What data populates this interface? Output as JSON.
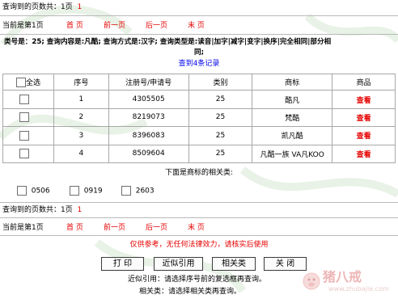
{
  "pager_top": {
    "total_label": "查询到的页数共：1页",
    "total_pages": "1",
    "current_label": "当前是第1页",
    "first": "首 页",
    "prev": "前一页",
    "next": "后一页",
    "last": "末 页"
  },
  "query_desc": "类号是：25; 查询内容是:凡酷; 查询方式是:汉字; 查询类型是:读音|加字|减字|变字|换序|完全相同|部分相",
  "query_desc_wrap": "同;",
  "result_count": "查到4条记录",
  "table": {
    "select_all": "全选",
    "headers": [
      "序号",
      "注册号/申请号",
      "类别",
      "商标",
      "商品"
    ],
    "rows": [
      {
        "seq": "1",
        "reg": "4305505",
        "cls": "25",
        "mark": "酷凡",
        "goods": "查看"
      },
      {
        "seq": "2",
        "reg": "8219073",
        "cls": "25",
        "mark": "梵酷",
        "goods": "查看"
      },
      {
        "seq": "3",
        "reg": "8396083",
        "cls": "25",
        "mark": "凯凡酷",
        "goods": "查看"
      },
      {
        "seq": "4",
        "reg": "8509604",
        "cls": "25",
        "mark": "凡酷一族 VA凡KOO",
        "goods": "查看"
      }
    ]
  },
  "related_title": "下面是商标的相关类:",
  "related_classes": [
    "0506",
    "0919",
    "2603"
  ],
  "pager_bottom": {
    "total_label": "查询到的页数共：1页",
    "total_pages": "1",
    "current_label": "当前是第1页",
    "first": "首 页",
    "prev": "前一页",
    "next": "后一页",
    "last": "末 页"
  },
  "disclaimer": "仅供参考，无任何法律效力，请核实后使用",
  "buttons": {
    "print": "打 印",
    "similar": "近似引用",
    "related": "相关类",
    "close": "关 闭"
  },
  "hint_similar": "近似引用：请选择序号前的复选框再查询。",
  "hint_related": "相关类：请选择相关类再查询。",
  "watermark": {
    "cn": "猪八戒",
    "url": "www.zhubajie.com"
  },
  "colors": {
    "accent_red": "#e60000",
    "link_blue": "#0000ee",
    "border_gray": "#a8a8a8"
  }
}
